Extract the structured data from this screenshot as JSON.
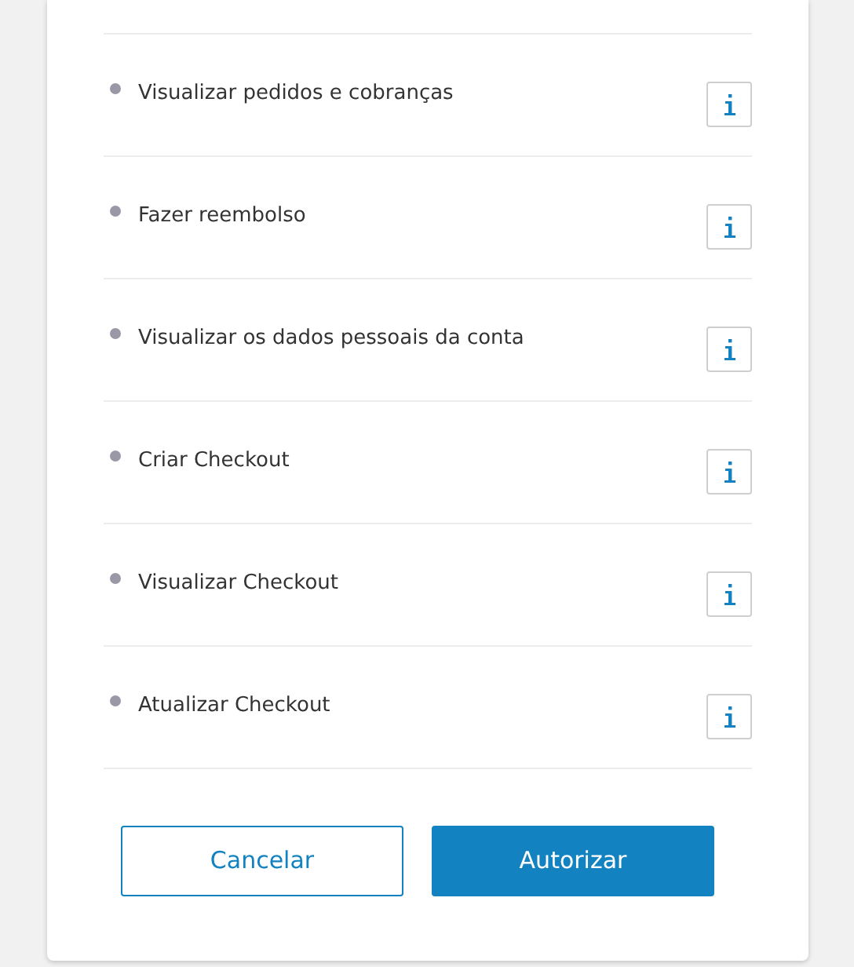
{
  "permissions": [
    {
      "label": "Visualizar pedidos e cobranças"
    },
    {
      "label": "Fazer reembolso"
    },
    {
      "label": "Visualizar os dados pessoais da conta"
    },
    {
      "label": "Criar Checkout"
    },
    {
      "label": "Visualizar Checkout"
    },
    {
      "label": "Atualizar Checkout"
    }
  ],
  "buttons": [
    {
      "label": "Cancelar",
      "kind": "secondary"
    },
    {
      "label": "Autorizar",
      "kind": "primary"
    }
  ]
}
